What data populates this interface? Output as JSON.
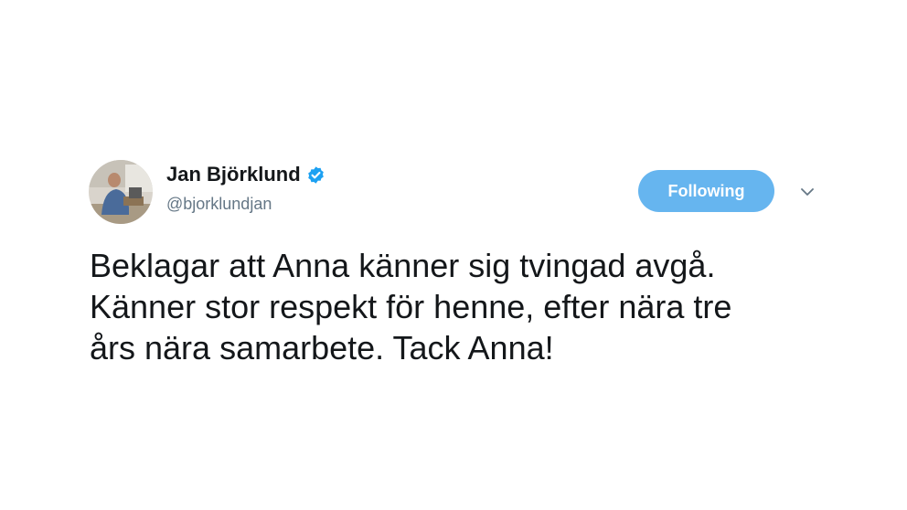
{
  "author": {
    "display_name": "Jan Björklund",
    "handle": "@bjorklundjan",
    "verified": true
  },
  "actions": {
    "follow_label": "Following"
  },
  "tweet": {
    "lines": [
      "Beklagar att Anna känner sig tvingad avgå.",
      "Känner stor respekt för henne, efter nära tre",
      "års nära samarbete. Tack Anna!"
    ]
  },
  "colors": {
    "follow_button_bg": "#66b5ef",
    "verified_badge": "#1da1f2",
    "name_text": "#14171a",
    "handle_text": "#657786"
  },
  "icons": {
    "verified": "verified-badge-icon",
    "menu": "chevron-down-icon"
  }
}
